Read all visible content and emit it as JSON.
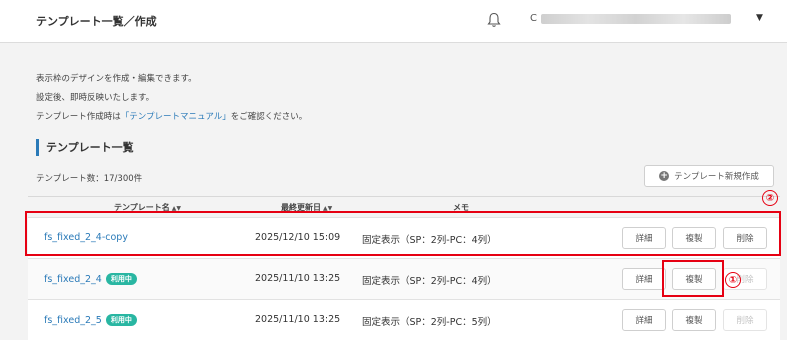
{
  "header": {
    "title": "テンプレート一覧／作成",
    "user_initial": "C"
  },
  "info": {
    "line1": "表示枠のデザインを作成・編集できます。",
    "line2": "設定後、即時反映いたします。",
    "line3_prefix": "テンプレート作成時は",
    "line3_link": "「テンプレートマニュアル」",
    "line3_suffix": "をご確認ください。"
  },
  "section_title": "テンプレート一覧",
  "count_text": "テンプレート数：17/300件",
  "new_button_label": "テンプレート新規作成",
  "table": {
    "headers": {
      "name": "テンプレート名",
      "updated": "最終更新日",
      "memo": "メモ"
    },
    "rows": [
      {
        "name": "fs_fixed_2_4-copy",
        "badge": "",
        "updated": "2025/12/10 15:09",
        "memo": "固定表示（SP：2列-PC：4列）",
        "detail": "詳細",
        "copy": "複製",
        "delete": "削除"
      },
      {
        "name": "fs_fixed_2_4",
        "badge": "利用中",
        "updated": "2025/11/10 13:25",
        "memo": "固定表示（SP：2列-PC：4列）",
        "detail": "詳細",
        "copy": "複製",
        "delete": "削除"
      },
      {
        "name": "fs_fixed_2_5",
        "badge": "利用中",
        "updated": "2025/11/10 13:25",
        "memo": "固定表示（SP：2列-PC：5列）",
        "detail": "詳細",
        "copy": "複製",
        "delete": "削除"
      }
    ]
  },
  "annotations": {
    "mark1": "①",
    "mark2": "②"
  },
  "colors": {
    "accent": "#2a7ab8",
    "badge": "#29b6a2",
    "highlight": "#e60012"
  }
}
